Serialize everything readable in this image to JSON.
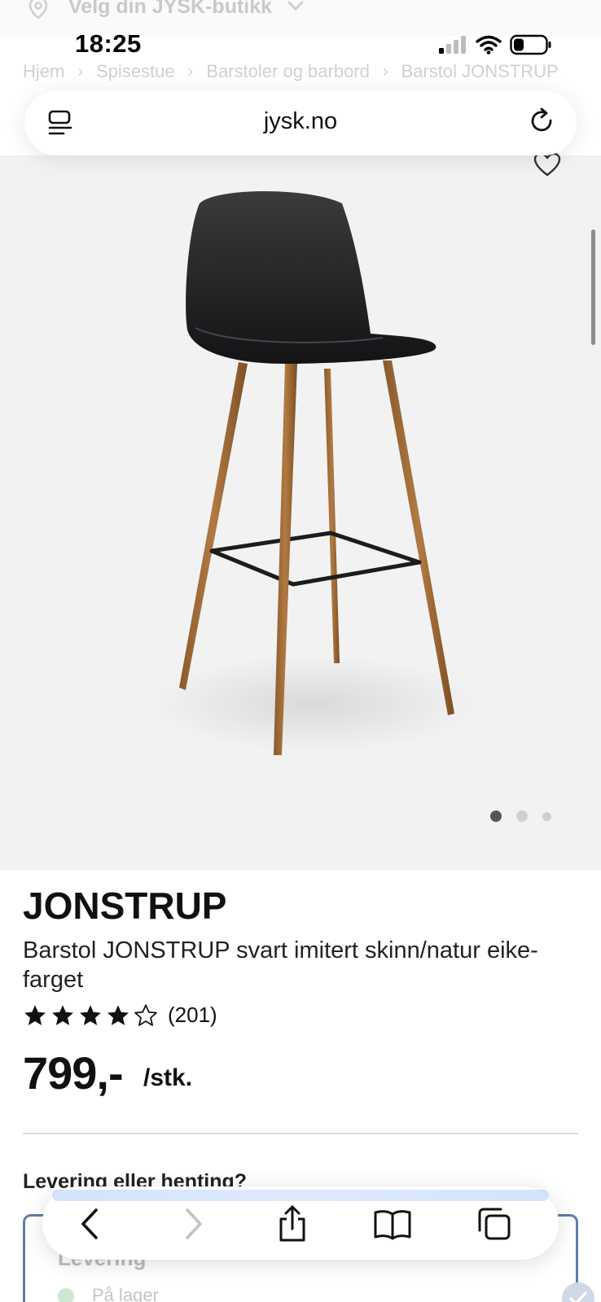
{
  "store_selector": {
    "label": "Velg din JYSK-butikk",
    "icon": "location-pin-icon"
  },
  "status_bar": {
    "time": "18:25"
  },
  "breadcrumb": [
    "Hjem",
    "Spisestue",
    "Barstoler og barbord",
    "Barstol JONSTRUP"
  ],
  "browser": {
    "url": "jysk.no"
  },
  "gallery": {
    "image_alt": "Barstol JONSTRUP",
    "total_images": 3,
    "active_index": 0
  },
  "product": {
    "name": "JONSTRUP",
    "description": "Barstol JONSTRUP svart imitert skinn/natur eike-farget",
    "rating": 4,
    "rating_max": 5,
    "review_count": "(201)",
    "price": "799,-",
    "unit": "/stk."
  },
  "delivery": {
    "heading": "Levering eller henting?",
    "option_title": "Levering",
    "stock_status": "På lager"
  },
  "colors": {
    "accent_border": "#5c7ea8",
    "stock_green": "#cde8d2"
  }
}
